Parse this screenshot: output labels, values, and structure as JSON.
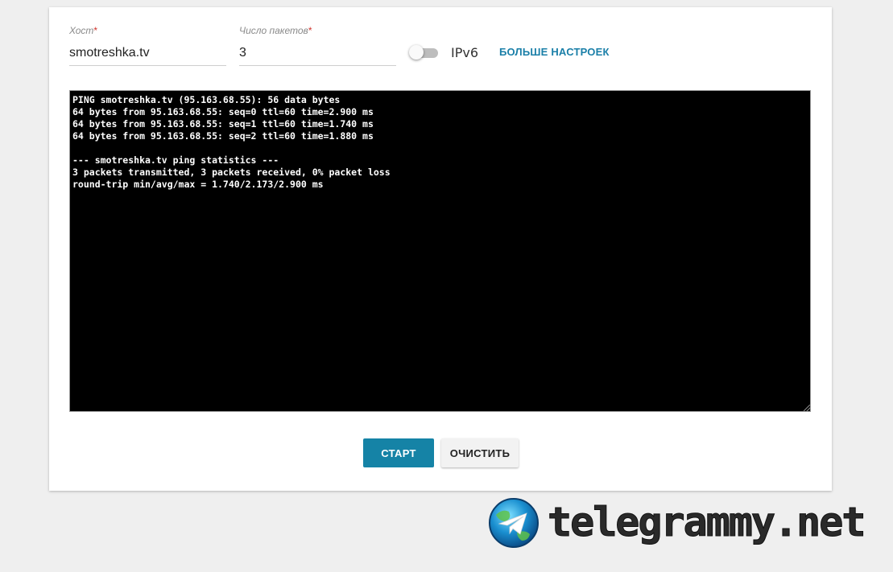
{
  "form": {
    "host_label": "Хост",
    "host_value": "smotreshka.tv",
    "packets_label": "Число пакетов",
    "packets_value": "3",
    "required_mark": "*",
    "ipv6_label": "IPv6",
    "ipv6_enabled": false,
    "more_settings": "БОЛЬШЕ НАСТРОЕК"
  },
  "terminal": {
    "output": "PING smotreshka.tv (95.163.68.55): 56 data bytes\n64 bytes from 95.163.68.55: seq=0 ttl=60 time=2.900 ms\n64 bytes from 95.163.68.55: seq=1 ttl=60 time=1.740 ms\n64 bytes from 95.163.68.55: seq=2 ttl=60 time=1.880 ms\n\n--- smotreshka.tv ping statistics ---\n3 packets transmitted, 3 packets received, 0% packet loss\nround-trip min/avg/max = 1.740/2.173/2.900 ms"
  },
  "buttons": {
    "start": "СТАРТ",
    "clear": "ОЧИСТИТЬ"
  },
  "watermark": {
    "text": "telegrammy.net",
    "icon": "telegram-globe-icon"
  },
  "colors": {
    "accent": "#1583a6",
    "link": "#1a7fa8",
    "required": "#d0342c",
    "terminal_bg": "#000000"
  }
}
